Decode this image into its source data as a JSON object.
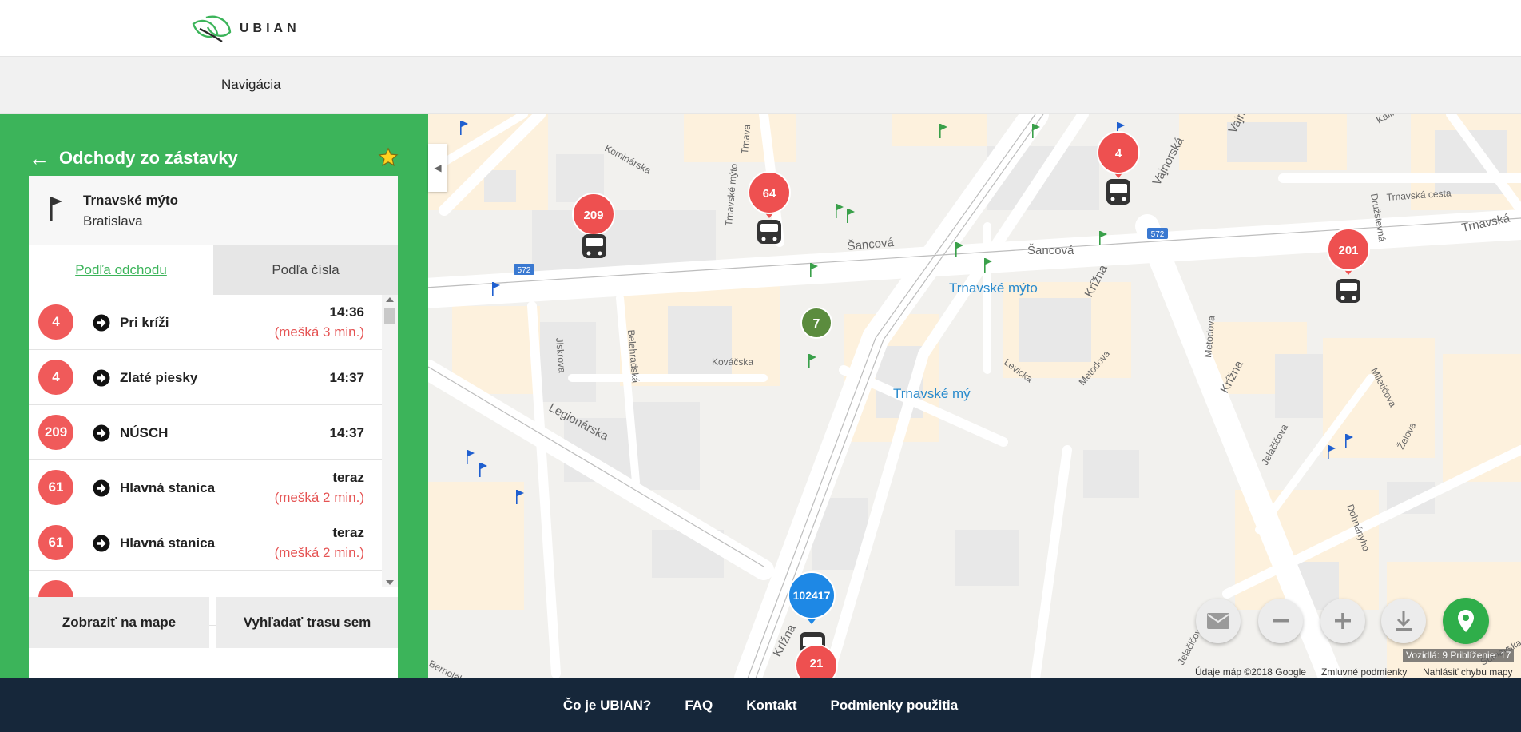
{
  "brand": {
    "name": "UBIAN"
  },
  "nav": {
    "item": "Navigácia"
  },
  "panel": {
    "title": "Odchody zo zástavky",
    "stop_name": "Trnavské mýto",
    "stop_city": "Bratislava",
    "tabs": [
      "Podľa odchodu",
      "Podľa čísla"
    ],
    "departures": [
      {
        "line": "4",
        "destination": "Pri kríži",
        "time": "14:36",
        "delay": "(mešká 3 min.)"
      },
      {
        "line": "4",
        "destination": "Zlaté piesky",
        "time": "14:37",
        "delay": ""
      },
      {
        "line": "209",
        "destination": "NÚSCH",
        "time": "14:37",
        "delay": ""
      },
      {
        "line": "61",
        "destination": "Hlavná stanica",
        "time": "teraz",
        "delay": "(mešká 2 min.)"
      },
      {
        "line": "61",
        "destination": "Hlavná stanica",
        "time": "teraz",
        "delay": "(mešká 2 min.)"
      }
    ],
    "show_on_map": "Zobraziť na mape",
    "find_route": "Vyhľadať trasu sem"
  },
  "map": {
    "streets": [
      "Šancová",
      "Šancová",
      "Trnavská cesta",
      "Trnavská",
      "Vajnorská",
      "Vajnorská",
      "Krížna",
      "Krížna",
      "Krížna",
      "Legionárska",
      "Jiskrova",
      "Belehradská",
      "Kováčska",
      "Levická",
      "Metodova",
      "Metodova",
      "Miletičova",
      "Jelačičova",
      "Jelačičova",
      "Dohnányho",
      "Želova",
      "Kominárska",
      "Kalinčiakova",
      "Družstevná",
      "Trnavské mýto",
      "Trnava",
      "Bernolákova",
      "Sumavska"
    ],
    "stop_labels": [
      "Trnavské mýto",
      "Trnavské mý"
    ],
    "road_badges": [
      "572",
      "572"
    ],
    "vehicles": [
      {
        "line": "209",
        "color": "#ee5050"
      },
      {
        "line": "64",
        "color": "#ee5050"
      },
      {
        "line": "4",
        "color": "#ee5050"
      },
      {
        "line": "201",
        "color": "#ee5050"
      },
      {
        "line": "102417",
        "color": "#1e88e5"
      },
      {
        "line": "21",
        "color": "#ee5050"
      }
    ],
    "cluster": {
      "count": "7",
      "color": "#5b8c3e"
    },
    "zoom_info": "Vozidlá: 9 Priblíženie: 17",
    "attribution": [
      "Údaje máp ©2018 Google",
      "Zmluvné podmienky",
      "Nahlásiť chybu mapy"
    ]
  },
  "footer": {
    "links": [
      "Čo je UBIAN?",
      "FAQ",
      "Kontakt",
      "Podmienky použitia"
    ]
  },
  "colors": {
    "brand_green": "#3cb45a",
    "badge_red": "#f05a5a",
    "footer": "#16273a",
    "delay_red": "#e55353"
  }
}
